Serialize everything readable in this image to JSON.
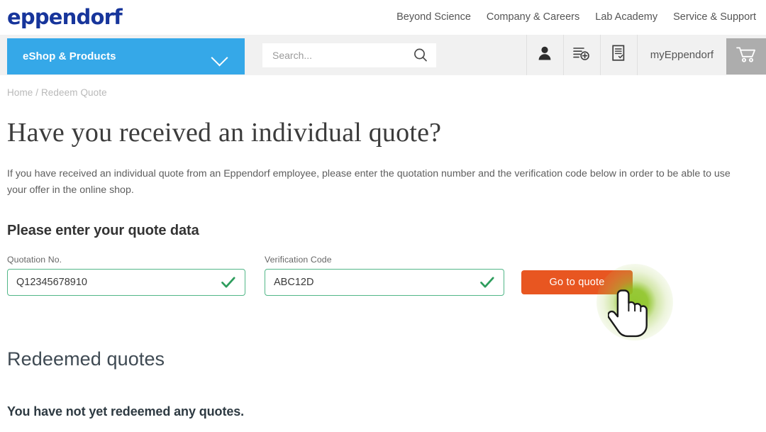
{
  "brand": {
    "logo_text": "eppendorf",
    "logo_color": "#17359b",
    "accent_blue": "#35a8e8",
    "accent_orange": "#e85621",
    "valid_green": "#52b788",
    "click_glow_green": "#8cc323"
  },
  "topnav": {
    "links": [
      {
        "label": "Beyond Science"
      },
      {
        "label": "Company & Careers"
      },
      {
        "label": "Lab Academy"
      },
      {
        "label": "Service & Support"
      }
    ]
  },
  "header": {
    "eshop_label": "eShop & Products",
    "chevron_icon": "chevron-down-icon",
    "search": {
      "value": "",
      "placeholder": "Search...",
      "icon": "search-icon"
    },
    "icons": [
      {
        "name": "account-icon"
      },
      {
        "name": "quick-order-list-add-icon"
      },
      {
        "name": "document-check-icon"
      }
    ],
    "my_eppendorf_label": "myEppendorf",
    "cart_icon": "shopping-cart-icon"
  },
  "breadcrumb": {
    "text": "Home / Redeem Quote"
  },
  "main": {
    "page_title": "Have you received an individual quote?",
    "intro": "If you have received an individual quote from an Eppendorf employee, please enter the quotation number and the verification code below in order to be able to use your offer in the online shop.",
    "section_title": "Please enter your quote data",
    "fields": [
      {
        "label": "Quotation No.",
        "value": "Q12345678910",
        "placeholder": "Quotation No.",
        "valid": true,
        "status_icon": "check-icon"
      },
      {
        "label": "Verification Code",
        "value": "ABC12D",
        "placeholder": "Verification Code",
        "valid": true,
        "status_icon": "check-icon"
      }
    ],
    "submit_label": "Go to quote"
  },
  "redeemed": {
    "title": "Redeemed quotes",
    "empty_message": "You have not yet redeemed any quotes."
  }
}
